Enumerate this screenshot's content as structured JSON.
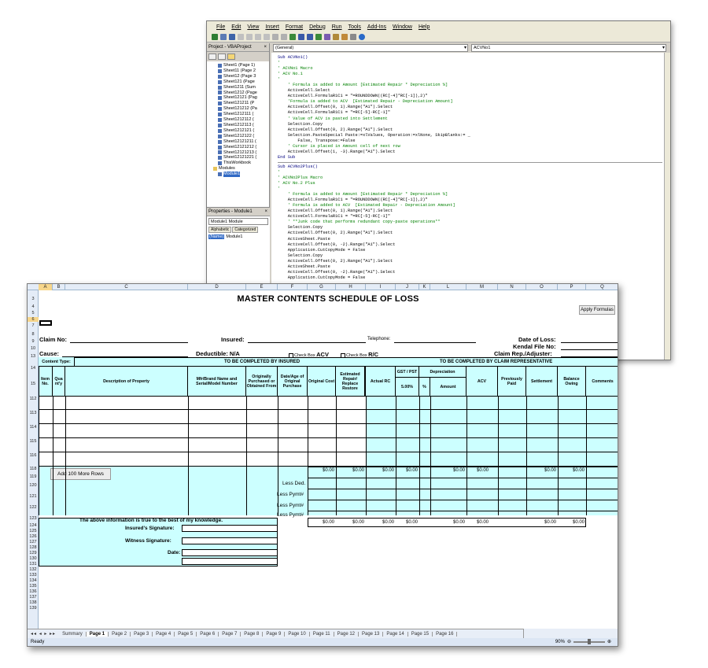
{
  "vba": {
    "menu": [
      "File",
      "Edit",
      "View",
      "Insert",
      "Format",
      "Debug",
      "Run",
      "Tools",
      "Add-Ins",
      "Window",
      "Help"
    ],
    "project_title": "Project - VBAProject",
    "tree": [
      "Sheet1 (Page 1)",
      "Sheet11 (Page 2",
      "Sheet12 (Page 3",
      "Sheet121 (Page",
      "Sheet1211 (Sum",
      "Sheet1212 (Page",
      "Sheet12121 (Pag",
      "Sheet121211 (P",
      "Sheet121212 (Pa",
      "Sheet1212111 (",
      "Sheet1212112 (",
      "Sheet1212113 (",
      "Sheet1212121 (",
      "Sheet1212122 (",
      "Sheet12121211 (",
      "Sheet12121212 (",
      "Sheet12121213 (",
      "Sheet12121221 (",
      "ThisWorkbook",
      "Modules",
      "Module1"
    ],
    "props_title": "Properties - Module1",
    "props_select": "Module1 Module",
    "props_tabs": [
      "Alphabetic",
      "Categorized"
    ],
    "props_key": "(Name)",
    "props_val": "Module1",
    "combo_left": "(General)",
    "combo_right": "ACVNo1",
    "code": [
      {
        "t": "k",
        "s": "Sub ACVNo1()"
      },
      {
        "t": "c",
        "s": "'"
      },
      {
        "t": "c",
        "s": "' ACVNo1 Macro"
      },
      {
        "t": "c",
        "s": "' ACV No.1"
      },
      {
        "t": "c",
        "s": "'"
      },
      {
        "t": "c",
        "s": "    ' Formula is added to Amount [Estimated Repair * Depreciation %]"
      },
      {
        "t": "n",
        "s": "    ActiveCell.Select"
      },
      {
        "t": "n",
        "s": "    ActiveCell.FormulaR1C1 = \"=ROUNDDOWN((RC[-4]*RC[-1]),2)\""
      },
      {
        "t": "c",
        "s": "    'Formula is added to ACV  [Estimated Repair - Depreciation Amount]"
      },
      {
        "t": "n",
        "s": "    ActiveCell.Offset(0, 1).Range(\"A1\").Select"
      },
      {
        "t": "n",
        "s": "    ActiveCell.FormulaR1C1 = \"=RC[-5]-RC[-1]\""
      },
      {
        "t": "c",
        "s": "    ' Value of ACV is pasted into Settlement"
      },
      {
        "t": "n",
        "s": "    Selection.Copy"
      },
      {
        "t": "n",
        "s": "    ActiveCell.Offset(0, 2).Range(\"A1\").Select"
      },
      {
        "t": "n",
        "s": "    Selection.PasteSpecial Paste:=xlValues, Operation:=xlNone, SkipBlanks:= _"
      },
      {
        "t": "n",
        "s": "        False, Transpose:=False"
      },
      {
        "t": "c",
        "s": "    ' Cursor is placed in Amount cell of next row"
      },
      {
        "t": "n",
        "s": "    ActiveCell.Offset(1, -3).Range(\"A1\").Select"
      },
      {
        "t": "k",
        "s": "End Sub"
      },
      {
        "t": "sep",
        "s": ""
      },
      {
        "t": "k",
        "s": "Sub ACVNo2Plus()"
      },
      {
        "t": "c",
        "s": "'"
      },
      {
        "t": "c",
        "s": "' ACVNo2Plus Macro"
      },
      {
        "t": "c",
        "s": "' ACV No.2 Plus"
      },
      {
        "t": "c",
        "s": "'"
      },
      {
        "t": "c",
        "s": "    ' Formula is added to Amount [Estimated Repair * Depreciation %]"
      },
      {
        "t": "n",
        "s": "    ActiveCell.FormulaR1C1 = \"=ROUNDDOWN((RC[-4]*RC[-1]),2)\""
      },
      {
        "t": "c",
        "s": "    ' Formula is added to ACV  [Estimated Repair - Depreciation Amount]"
      },
      {
        "t": "n",
        "s": "    ActiveCell.Offset(0, 1).Range(\"A1\").Select"
      },
      {
        "t": "n",
        "s": "    ActiveCell.FormulaR1C1 = \"=RC[-5]-RC[-1]\""
      },
      {
        "t": "c",
        "s": "    ' **Junk code that performs redundant copy-paste operations**"
      },
      {
        "t": "n",
        "s": "    Selection.Copy"
      },
      {
        "t": "n",
        "s": "    ActiveCell.Offset(0, 2).Range(\"A1\").Select"
      },
      {
        "t": "n",
        "s": "    ActiveSheet.Paste"
      },
      {
        "t": "n",
        "s": "    ActiveCell.Offset(0, -2).Range(\"A1\").Select"
      },
      {
        "t": "n",
        "s": "    Application.CutCopyMode = False"
      },
      {
        "t": "n",
        "s": "    Selection.Copy"
      },
      {
        "t": "n",
        "s": "    ActiveCell.Offset(0, 2).Range(\"A1\").Select"
      },
      {
        "t": "n",
        "s": "    ActiveSheet.Paste"
      },
      {
        "t": "n",
        "s": "    ActiveCell.Offset(0, -2).Range(\"A1\").Select"
      },
      {
        "t": "n",
        "s": "    Application.CutCopyMode = False"
      }
    ]
  },
  "excel": {
    "columns": [
      "A",
      "B",
      "C",
      "D",
      "E",
      "F",
      "G",
      "H",
      "I",
      "J",
      "K",
      "L",
      "M",
      "N",
      "O",
      "P",
      "Q"
    ],
    "title": "MASTER CONTENTS SCHEDULE OF LOSS",
    "apply_button": "Apply Formulas",
    "add_rows_button": "Add 100 More Rows",
    "claim_no": "Claim No:",
    "insured": "Insured:",
    "telephone": "Telephone:",
    "date_of_loss": "Date of Loss:",
    "kendal_file": "Kendal File No:",
    "cause": "Cause:",
    "deductible": "Deductible: N/A",
    "check_acv_box": "Check Box",
    "check_acv": "ACV",
    "check_rc_box": "Check Box",
    "check_rc": "R/C",
    "claim_rep": "Claim Rep./Adjuster:",
    "content_type": "Content Type:",
    "insured_section": "TO BE COMPLETED BY INSURED",
    "rep_section": "TO BE COMPLETED BY CLAIM REPRESENTATIVE",
    "headers": {
      "item_no": "Item No.",
      "quantity": "Qua nt'y",
      "description": "Description of Property",
      "mfr": "Mfr/Brand Name and Serial/Model Number",
      "purchased": "Originally Purchased or Obtained From",
      "date_age": "Date/Age of Original Purchase",
      "orig_cost": "Original Cost",
      "est_repair": "Estimated Repair/ Replace Restore",
      "actual_rc": "Actual RC",
      "gst": "GST / PST",
      "gst_rate": "5.00%",
      "depreciation": "Depreciation",
      "dep_pct": "%",
      "dep_amt": "Amount",
      "acv": "ACV",
      "prev_paid": "Previously Paid",
      "settlement": "Settlement",
      "balance": "Balance Owing",
      "comments": "Comments"
    },
    "totals": {
      "orig_cost": "$0.00",
      "est_repair": "$0.00",
      "actual_rc": "$0.00",
      "gst": "$0.00",
      "dep_amt": "$0.00",
      "acv": "$0.00",
      "settlement": "$0.00",
      "balance": "$0.00"
    },
    "less_ded": "Less Ded.",
    "less_pymt1": "Less Pymt#",
    "less_pymt2": "Less Pymt#",
    "less_pymt3": "Less Pymt#",
    "totals2": {
      "orig_cost": "$0.00",
      "est_repair": "$0.00",
      "actual_rc": "$0.00",
      "gst": "$0.00",
      "dep_amt": "$0.00",
      "acv": "$0.00",
      "settlement": "$0.00",
      "balance": "$0.00"
    },
    "declaration": "The above information is true to the best of my knowledge.",
    "insured_sig": "Insured's Signature:",
    "witness_sig": "Witness Signature:",
    "date_label": "Date:",
    "row_numbers": [
      "3",
      "4",
      "5",
      "6",
      "7",
      "8",
      "9",
      "10",
      "13",
      "14",
      "15",
      "112",
      "113",
      "114",
      "115",
      "116",
      "118",
      "119",
      "120",
      "121",
      "122",
      "123",
      "124",
      "125",
      "126",
      "127",
      "128",
      "129",
      "130",
      "131",
      "132",
      "133",
      "134",
      "135",
      "136",
      "137",
      "138",
      "139"
    ],
    "sheet_tabs": [
      "Summary",
      "Page 1",
      "Page 2",
      "Page 3",
      "Page 4",
      "Page 5",
      "Page 6",
      "Page 7",
      "Page 8",
      "Page 9",
      "Page 10",
      "Page 11",
      "Page 12",
      "Page 13",
      "Page 14",
      "Page 15",
      "Page 16"
    ],
    "active_tab": "Page 1",
    "status": "Ready",
    "zoom": "90%"
  }
}
